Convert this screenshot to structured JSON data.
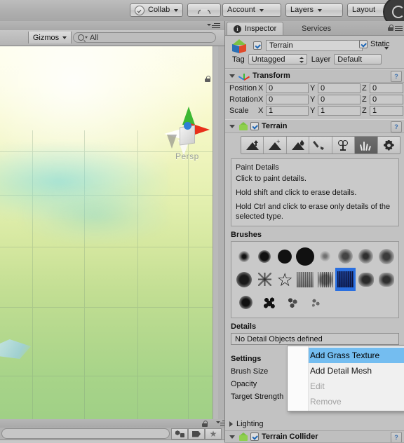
{
  "toolbar": {
    "collab": "Collab",
    "cloud_icon": "cloud-icon",
    "account": "Account",
    "layers": "Layers",
    "layout": "Layout"
  },
  "scene": {
    "gizmos": "Gizmos",
    "search_value": "All",
    "perspective_label": "Persp",
    "rotate_icon": "rotate-icon"
  },
  "hierarchy_bar": {
    "search_value": "",
    "icons": [
      "object-filter-icon",
      "tag-filter-icon",
      "favorite-filter-icon"
    ]
  },
  "inspector": {
    "tabs": [
      {
        "label": "Inspector",
        "active": true
      },
      {
        "label": "Services",
        "active": false
      }
    ],
    "object": {
      "name": "Terrain",
      "enabled": true,
      "static_label": "Static",
      "static_checked": true,
      "tag_label": "Tag",
      "tag_value": "Untagged",
      "layer_label": "Layer",
      "layer_value": "Default"
    },
    "transform": {
      "title": "Transform",
      "rows": [
        {
          "label": "Position",
          "x": "0",
          "y": "0",
          "z": "0"
        },
        {
          "label": "Rotation",
          "x": "0",
          "y": "0",
          "z": "0"
        },
        {
          "label": "Scale",
          "x": "1",
          "y": "1",
          "z": "1"
        }
      ],
      "axes": [
        "X",
        "Y",
        "Z"
      ]
    },
    "terrain": {
      "title": "Terrain",
      "enabled": true,
      "tools": [
        {
          "name": "raise-lower-terrain-tool",
          "selected": false
        },
        {
          "name": "paint-height-tool",
          "selected": false
        },
        {
          "name": "smooth-height-tool",
          "selected": false
        },
        {
          "name": "paint-texture-tool",
          "selected": false
        },
        {
          "name": "place-trees-tool",
          "selected": false
        },
        {
          "name": "paint-details-tool",
          "selected": true
        },
        {
          "name": "terrain-settings-tool",
          "selected": false
        }
      ],
      "help": {
        "title": "Paint Details",
        "lines": [
          "Click to paint details.",
          "Hold shift and click to erase details.",
          "Hold Ctrl and click to erase only details of the selected type."
        ]
      },
      "brushes_title": "Brushes",
      "brushes": {
        "columns": 8,
        "selected_index": 13,
        "count": 20
      },
      "details_title": "Details",
      "details_empty": "No Detail Objects defined",
      "settings_title": "Settings",
      "settings": [
        "Brush Size",
        "Opacity",
        "Target Strength"
      ],
      "lighting": "Lighting"
    },
    "terrain_collider": {
      "title": "Terrain Collider",
      "enabled": true
    }
  },
  "context_menu": {
    "items": [
      {
        "label": "Add Grass Texture",
        "highlighted": true,
        "disabled": false
      },
      {
        "label": "Add Detail Mesh",
        "highlighted": false,
        "disabled": false
      },
      {
        "label": "Edit",
        "highlighted": false,
        "disabled": true
      },
      {
        "label": "Remove",
        "highlighted": false,
        "disabled": true
      }
    ]
  },
  "colors": {
    "menu_highlight": "#74bdf0",
    "brush_selected": "#2a6fe0",
    "panel_bg": "#c2c2c2",
    "toolbar_bg": "#b0b0b0"
  }
}
